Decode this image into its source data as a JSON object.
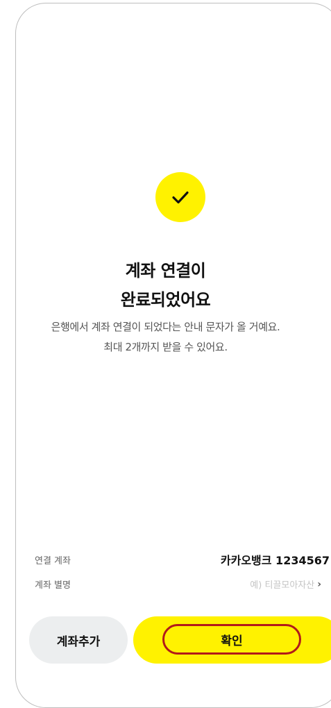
{
  "success": {
    "icon": "checkmark-icon",
    "title_line1": "계좌 연결이",
    "title_line2": "완료되었어요",
    "description_line1": "은행에서 계좌 연결이 되었다는 안내 문자가 올 거예요.",
    "description_line2": "최대 2개까지 받을 수 있어요."
  },
  "account_info": {
    "linked_account_label": "연결 계좌",
    "linked_account_value": "카카오뱅크 1234567",
    "nickname_label": "계좌 별명",
    "nickname_placeholder": "예) 티끌모아자산",
    "nickname_chevron": "›"
  },
  "buttons": {
    "add_account": "계좌추가",
    "confirm": "확인"
  },
  "colors": {
    "accent_yellow": "#fff200",
    "secondary_button": "#eceeef",
    "highlight_outline": "#b11a1a"
  }
}
